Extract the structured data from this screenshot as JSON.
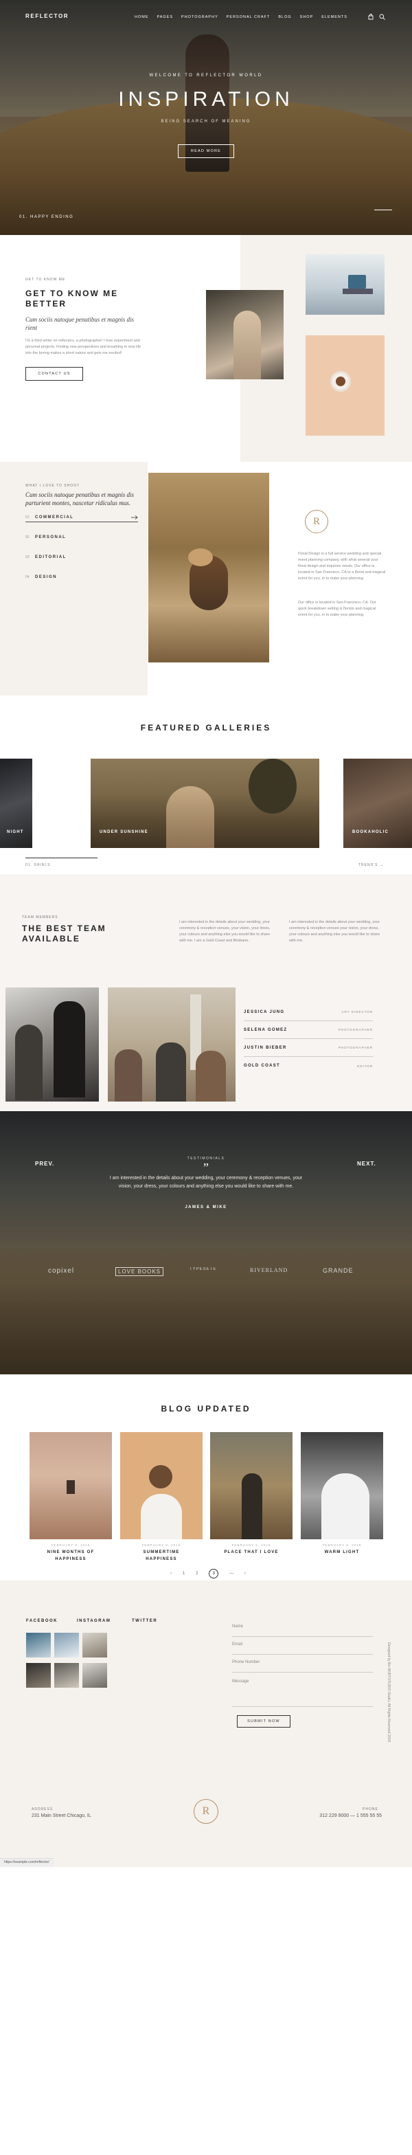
{
  "header": {
    "logo": "REFLECTOR",
    "nav": [
      "HOME",
      "PAGES",
      "PHOTOGRAPHY",
      "PERSONAL CRAFT",
      "BLOG",
      "SHOP",
      "ELEMENTS"
    ],
    "icons": [
      "bag-icon",
      "search-icon"
    ]
  },
  "hero": {
    "kicker": "WELCOME TO REFLECTOR WORLD",
    "title": "INSPIRATION",
    "subtitle": "BEING SEARCH OF MEANING",
    "button": "READ MORE",
    "slide_label": "01. HAPPY ENDING"
  },
  "about": {
    "kicker": "GET TO KNOW ME",
    "title_line1": "GET TO KNOW ME",
    "title_line2": "BETTER",
    "lead": "Cum sociis natoque penatibus et magnis dis rient",
    "body": "I'm a third writer on reflectors, a photographer! I love experiment and personal projects. Finding new perspectives and breathing in new life into the boring makes a short nature and gets me excited!",
    "button": "CONTACT US"
  },
  "personal": {
    "kicker": "WHAT I LOVE TO SHOOT",
    "lead": "Cum sociis natoque penatibus et magnis dis parturient montes, nascetur ridiculus mus.",
    "menu": [
      {
        "num": "01",
        "label": "COMMERCIAL"
      },
      {
        "num": "02",
        "label": "PERSONAL"
      },
      {
        "num": "03",
        "label": "EDITORIAL"
      },
      {
        "num": "04",
        "label": "DESIGN"
      }
    ],
    "seal_letter": "R",
    "body1": "Floral Design is a full service wedding and special event planning company, with what several your floral design and inquiries needs. Our office is located in San Francisco, CA to a florist and magical event for you, in to make your planning.",
    "body2": "Our office is located in San Francisco, CA. Our quick breakdown setting is florists and magical event for you, in to make your planning."
  },
  "galleries": {
    "title": "FEATURED GALLERIES",
    "items": [
      "NIGHT",
      "UNDER SUNSHINE",
      "BOOKAHOLIC"
    ],
    "prev": "01. SHIRLS",
    "next": "TREND'S"
  },
  "team": {
    "kicker": "TEAM MEMBERS",
    "title_line1": "THE BEST TEAM",
    "title_line2": "AVAILABLE",
    "col1": "I am interested in the details about your wedding, your ceremony & reception venues, your vision, your dress, your colours and anything else you would like to share with me. I am a Gold Coast and Brisbane.",
    "col2": "I am interested in the details about your wedding, your ceremony & reception venues your vision, your dress, your colours and anything else you would like to share with me.",
    "members": [
      {
        "name": "JESSICA JUNG",
        "role": "ART DIRECTOR"
      },
      {
        "name": "SELENA GOMEZ",
        "role": "PHOTOGRAPHER"
      },
      {
        "name": "JUSTIN BIEBER",
        "role": "PHOTOGRAPHER"
      },
      {
        "name": "GOLD COAST",
        "role": "EDITOR"
      }
    ]
  },
  "testimonial": {
    "kicker": "TESTIMONIALS",
    "quote_mark": "”",
    "quote": "I am interested in the details about your wedding, your ceremony & reception venues, your vision, your dress, your colours and anything else you would like to share with me.",
    "author": "JAMES & MIKE",
    "prev": "PREV.",
    "next": "NEXT.",
    "logos": [
      "copixel",
      "LOVE BOOKS",
      "TYPESETE",
      "RIVERLAND",
      "GRANDE"
    ]
  },
  "blog": {
    "title": "BLOG UPDATED",
    "posts": [
      {
        "date": "FEBRUARY 9, 2018",
        "title_line1": "NINE MONTHS OF",
        "title_line2": "HAPPINESS"
      },
      {
        "date": "FEBRUARY 9, 2018",
        "title_line1": "SUMMERTIME",
        "title_line2": "HAPPINESS"
      },
      {
        "date": "FEBRUARY 9, 2018",
        "title_line1": "PLACE THAT I LOVE",
        "title_line2": ""
      },
      {
        "date": "FEBRUARY 9, 2018",
        "title_line1": "WARM LIGHT",
        "title_line2": ""
      }
    ],
    "pages": [
      "‹",
      "1",
      "2",
      "3",
      "—",
      "›"
    ]
  },
  "footer": {
    "social": [
      "FACEBOOK",
      "INSTAGRAM",
      "TWITTER"
    ],
    "form": {
      "name": "Name",
      "email": "Email",
      "phone": "Phone Number",
      "message": "Message",
      "submit": "SUBMIT NOW"
    },
    "side_text": "Designed by Bo-SKIRTSTUDIO Studio, All Rights Reserved 2018",
    "address_label": "ADDRESS",
    "address": "231 Main Street Chicago, IL",
    "seal": "R",
    "phone_label": "PHONE",
    "phone": "312 229 9000 — 1 555 55 55",
    "status_url": "https://example.com/reflector/"
  },
  "colors": {
    "accent": "#b5926a",
    "bg_light": "#f5f1ed",
    "dark": "#222222"
  }
}
